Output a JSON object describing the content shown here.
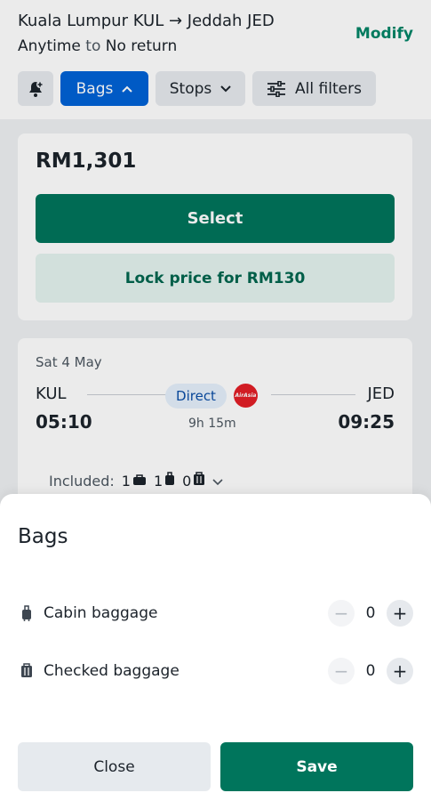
{
  "header": {
    "route": "Kuala Lumpur KUL → Jeddah JED",
    "dates_from": "Anytime",
    "dates_connector": "to",
    "dates_to": "No return",
    "modify_label": "Modify"
  },
  "filters": {
    "alert_icon": "bell-plus-icon",
    "bags_label": "Bags",
    "stops_label": "Stops",
    "all_filters_label": "All filters"
  },
  "result_card": {
    "price": "RM1,301",
    "select_label": "Select",
    "lock_label": "Lock price for RM130"
  },
  "flight": {
    "date": "Sat 4 May",
    "origin": "KUL",
    "destination": "JED",
    "departure": "05:10",
    "arrival": "09:25",
    "badge": "Direct",
    "airline_logo_text": "AirAsia",
    "duration": "9h 15m",
    "included_label": "Included:",
    "personal_item_count": "1",
    "cabin_count": "1",
    "checked_count": "0"
  },
  "bags_sheet": {
    "title": "Bags",
    "cabin_label": "Cabin baggage",
    "cabin_value": "0",
    "checked_label": "Checked baggage",
    "checked_value": "0",
    "minus_symbol": "−",
    "plus_symbol": "+",
    "close_label": "Close",
    "save_label": "Save"
  },
  "colors": {
    "primary_green": "#00755c",
    "active_blue": "#0062d6",
    "link_green": "#008566",
    "airline_red": "#e31f26"
  }
}
